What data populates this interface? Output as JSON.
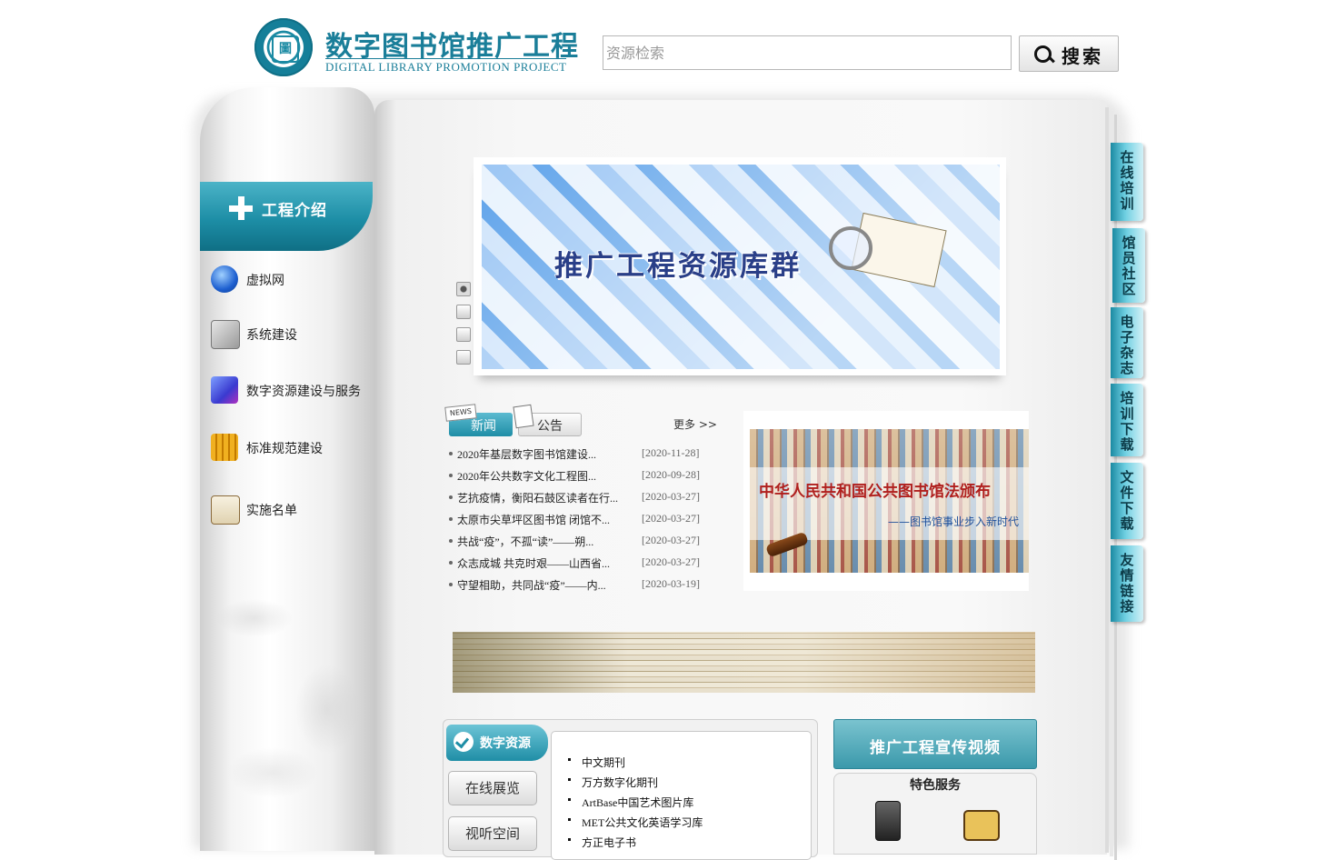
{
  "header": {
    "logo_cn": "数字图书馆推广工程",
    "logo_en": "DIGITAL LIBRARY PROMOTION PROJECT",
    "logo_emblem_glyph": "圖",
    "search": {
      "placeholder": "资源检索",
      "value": "",
      "button_label": "搜索"
    }
  },
  "nav": {
    "header_label": "工程介绍",
    "items": [
      {
        "label": "虚拟网",
        "icon": "globe-icon"
      },
      {
        "label": "系统建设",
        "icon": "system-chart-icon"
      },
      {
        "label": "数字资源建设与服务",
        "icon": "resource-slides-icon"
      },
      {
        "label": "标准规范建设",
        "icon": "standard-film-icon"
      },
      {
        "label": "实施名单",
        "icon": "clipboard-icon"
      }
    ]
  },
  "banner": {
    "title": "推广工程资源库群",
    "slides_count": 4,
    "active_slide": 1
  },
  "news": {
    "tabs": [
      {
        "label": "新闻",
        "badge": "NEWS"
      },
      {
        "label": "公告"
      }
    ],
    "more_label": "更多 >>",
    "items": [
      {
        "title": "2020年基层数字图书馆建设...",
        "date": "[2020-11-28]"
      },
      {
        "title": "2020年公共数字文化工程图...",
        "date": "[2020-09-28]"
      },
      {
        "title": "艺抗疫情，衡阳石鼓区读者在行...",
        "date": "[2020-03-27]"
      },
      {
        "title": "太原市尖草坪区图书馆 闭馆不...",
        "date": "[2020-03-27]"
      },
      {
        "title": "共战“疫”，不孤“读”——朔...",
        "date": "[2020-03-27]"
      },
      {
        "title": "众志成城 共克时艰——山西省...",
        "date": "[2020-03-27]"
      },
      {
        "title": "守望相助，共同战“疫”——内...",
        "date": "[2020-03-19]"
      }
    ]
  },
  "promo": {
    "title": "中华人民共和国公共图书馆法颁布",
    "subtitle": "——图书馆事业步入新时代"
  },
  "resources": {
    "tab_label": "数字资源",
    "side_buttons": [
      "在线展览",
      "视听空间"
    ],
    "items": [
      "中文期刊",
      "万方数字化期刊",
      "ArtBase中国艺术图片库",
      "MET公共文化英语学习库",
      "方正电子书"
    ]
  },
  "video": {
    "header_label": "推广工程宣传视频",
    "service_title": "特色服务"
  },
  "side_tabs": [
    "在线培训",
    "馆员社区",
    "电子杂志",
    "培训下载",
    "文件下载",
    "友情链接"
  ],
  "colors": {
    "accent": "#1f8ea6",
    "accent_light": "#6cc4d6",
    "promo_red": "#b0201e",
    "banner_title": "#2a3f88"
  }
}
